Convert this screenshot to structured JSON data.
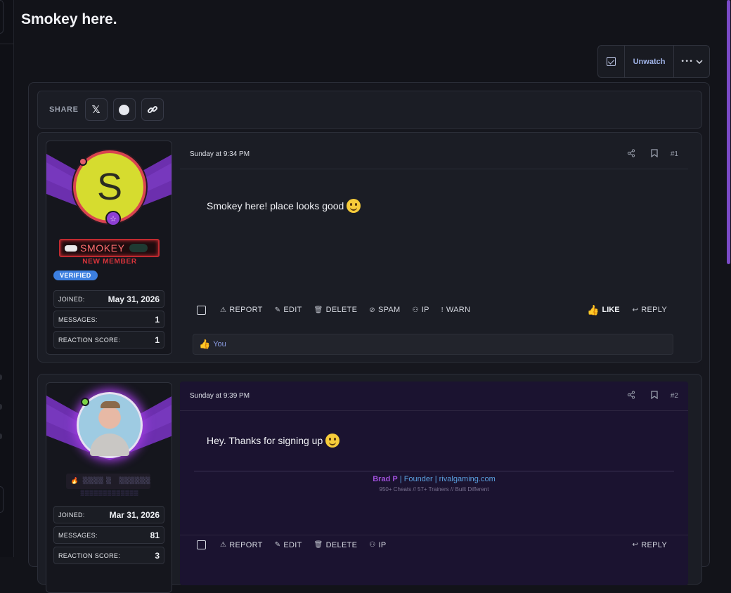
{
  "thread": {
    "title": "Smokey here."
  },
  "watch": {
    "unwatch_label": "Unwatch",
    "more_label": "•••"
  },
  "share": {
    "label": "SHARE",
    "x_label": "𝕏"
  },
  "posts": [
    {
      "date": "Sunday at 9:34 PM",
      "number": "#1",
      "avatar_letter": "S",
      "username": "SMOKEY",
      "user_title": "NEW MEMBER",
      "verified": "VERIFIED",
      "stats": [
        {
          "k": "JOINED:",
          "v": "May 31, 2026"
        },
        {
          "k": "MESSAGES:",
          "v": "1"
        },
        {
          "k": "REACTION SCORE:",
          "v": "1"
        }
      ],
      "content": "Smokey here! place looks good",
      "actions": [
        "REPORT",
        "EDIT",
        "DELETE",
        "SPAM",
        "IP",
        "WARN"
      ],
      "like_label": "LIKE",
      "reply_label": "REPLY",
      "reaction_user": "You"
    },
    {
      "date": "Sunday at 9:39 PM",
      "number": "#2",
      "stats": [
        {
          "k": "JOINED:",
          "v": "Mar 31, 2026"
        },
        {
          "k": "MESSAGES:",
          "v": "81"
        },
        {
          "k": "REACTION SCORE:",
          "v": "3"
        }
      ],
      "content": "Hey. Thanks for signing up",
      "signature": {
        "name": "Brad P",
        "role": "Founder",
        "site": "rivalgaming.com",
        "tagline": "950+ Cheats // 57+ Trainers // Built Different"
      },
      "actions": [
        "REPORT",
        "EDIT",
        "DELETE",
        "IP"
      ],
      "reply_label": "REPLY"
    }
  ],
  "colors": {
    "accent": "#7b4bc7",
    "like": "#f5c73c",
    "verified": "#3c7fe0",
    "username_red": "#ff6c6f"
  }
}
